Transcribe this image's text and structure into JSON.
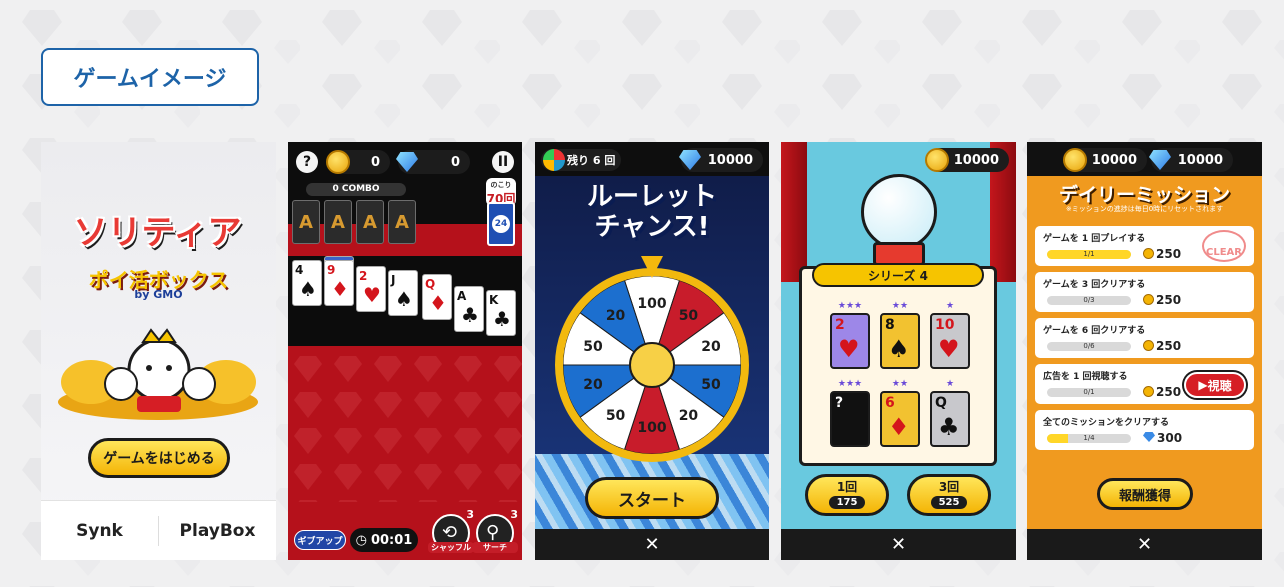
{
  "section": {
    "title": "ゲームイメージ"
  },
  "screen1": {
    "logo_main": "ソリティア",
    "logo_sub": "ポイ活ボックス",
    "logo_by": "by GMO",
    "start_button": "ゲームをはじめる",
    "footer": {
      "brand_left": "Synk",
      "brand_right": "PlayBox"
    }
  },
  "screen2": {
    "help_label": "?",
    "coins": "0",
    "gems": "0",
    "pause_label": "II",
    "combo": "0 COMBO",
    "foundations": [
      "A",
      "A",
      "A",
      "A"
    ],
    "remaining_caption": "のこり",
    "remaining_count": "70回",
    "deck_count": "24",
    "cards": [
      {
        "rank": "4",
        "suit": "♠",
        "color": "black"
      },
      {
        "rank": "9",
        "suit": "♦",
        "color": "red"
      },
      {
        "rank": "2",
        "suit": "♥",
        "color": "red"
      },
      {
        "rank": "J",
        "suit": "♠",
        "color": "black"
      },
      {
        "rank": "Q",
        "suit": "♦",
        "color": "red"
      },
      {
        "rank": "A",
        "suit": "♣",
        "color": "black"
      },
      {
        "rank": "K",
        "suit": "♣",
        "color": "black"
      }
    ],
    "giveup": "ギブアップ",
    "timer": "00:01",
    "shuffle": {
      "label": "シャッフル",
      "count": "3"
    },
    "search": {
      "label": "サーチ",
      "count": "3"
    }
  },
  "screen3": {
    "remaining": "残り 6 回",
    "gems": "10000",
    "title_line1": "ルーレット",
    "title_line2": "チャンス!",
    "wheel_values": [
      "100",
      "50",
      "20",
      "50",
      "20",
      "100",
      "50",
      "20",
      "50",
      "20"
    ],
    "start_button": "スタート",
    "close": "✕"
  },
  "screen4": {
    "coins": "10000",
    "series": "シリーズ 4",
    "cards": [
      {
        "rank": "2",
        "suit": "♥",
        "stars": "★★★",
        "bg": "#9d87e8",
        "text": "#d4151c"
      },
      {
        "rank": "8",
        "suit": "♠",
        "stars": "★★",
        "bg": "#f2c230",
        "text": "#111111"
      },
      {
        "rank": "10",
        "suit": "♥",
        "stars": "★",
        "bg": "#c8c8cc",
        "text": "#d4151c"
      },
      {
        "rank": "?",
        "suit": "",
        "stars": "★★★",
        "bg": "#111111",
        "text": "#ffffff"
      },
      {
        "rank": "6",
        "suit": "♦",
        "stars": "★★",
        "bg": "#f2c230",
        "text": "#d4151c"
      },
      {
        "rank": "Q",
        "suit": "♣",
        "stars": "★",
        "bg": "#c8c8cc",
        "text": "#111111"
      }
    ],
    "draw_once": {
      "label": "1回",
      "cost": "175"
    },
    "draw_three": {
      "label": "3回",
      "cost": "525"
    },
    "close": "✕"
  },
  "screen5": {
    "coins": "10000",
    "gems": "10000",
    "title": "デイリーミッション",
    "note": "※ミッションの進捗は毎日0時にリセットされます",
    "missions": [
      {
        "title": "ゲームを 1 回プレイする",
        "progress": "1/1",
        "ratio": 1.0,
        "reward": "250",
        "reward_type": "coin"
      },
      {
        "title": "ゲームを 3 回クリアする",
        "progress": "0/3",
        "ratio": 0.0,
        "reward": "250",
        "reward_type": "coin"
      },
      {
        "title": "ゲームを 6 回クリアする",
        "progress": "0/6",
        "ratio": 0.0,
        "reward": "250",
        "reward_type": "coin"
      },
      {
        "title": "広告を 1 回視聴する",
        "progress": "0/1",
        "ratio": 0.0,
        "reward": "250",
        "reward_type": "coin"
      },
      {
        "title": "全てのミッションをクリアする",
        "progress": "1/4",
        "ratio": 0.25,
        "reward": "300",
        "reward_type": "gem"
      }
    ],
    "clear_stamp": "CLEAR",
    "watch_button": "視聴",
    "reward_button": "報酬獲得",
    "close": "✕"
  }
}
